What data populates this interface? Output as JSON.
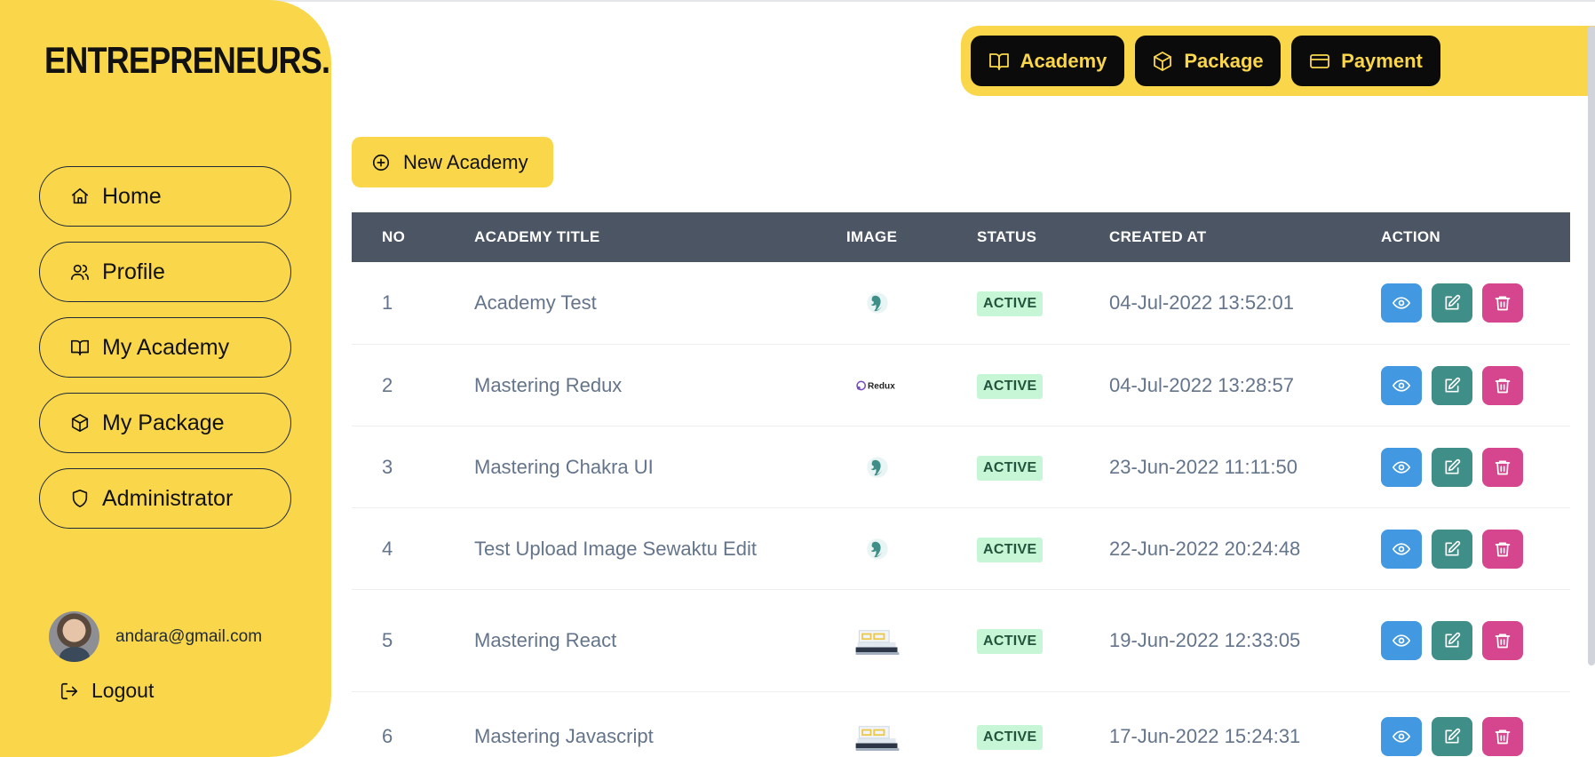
{
  "brand": {
    "logo_text": "ENTREPRENEURS."
  },
  "sidebar": {
    "items": [
      {
        "label": "Home",
        "icon": "home-icon"
      },
      {
        "label": "Profile",
        "icon": "users-icon"
      },
      {
        "label": "My Academy",
        "icon": "book-icon"
      },
      {
        "label": "My Package",
        "icon": "box-icon"
      },
      {
        "label": "Administrator",
        "icon": "shield-icon"
      }
    ],
    "user": {
      "email": "andara@gmail.com"
    },
    "logout_label": "Logout"
  },
  "topbar": {
    "buttons": [
      {
        "label": "Academy",
        "icon": "book-icon"
      },
      {
        "label": "Package",
        "icon": "box-icon"
      },
      {
        "label": "Payment",
        "icon": "card-icon"
      }
    ]
  },
  "main": {
    "new_button_label": "New Academy",
    "table": {
      "headers": [
        "NO",
        "ACADEMY TITLE",
        "IMAGE",
        "STATUS",
        "CREATED AT",
        "ACTION"
      ],
      "rows": [
        {
          "no": "1",
          "title": "Academy Test",
          "image": "chakra-logo",
          "status": "ACTIVE",
          "created_at": "04-Jul-2022 13:52:01"
        },
        {
          "no": "2",
          "title": "Mastering Redux",
          "image": "redux-logo",
          "image_text": "Redux",
          "status": "ACTIVE",
          "created_at": "04-Jul-2022 13:28:57"
        },
        {
          "no": "3",
          "title": "Mastering Chakra UI",
          "image": "chakra-logo",
          "status": "ACTIVE",
          "created_at": "23-Jun-2022 11:11:50"
        },
        {
          "no": "4",
          "title": "Test Upload Image Sewaktu Edit",
          "image": "chakra-logo",
          "status": "ACTIVE",
          "created_at": "22-Jun-2022 20:24:48"
        },
        {
          "no": "5",
          "title": "Mastering React",
          "image": "books-photo",
          "status": "ACTIVE",
          "created_at": "19-Jun-2022 12:33:05"
        },
        {
          "no": "6",
          "title": "Mastering Javascript",
          "image": "books-photo",
          "status": "ACTIVE",
          "created_at": "17-Jun-2022 15:24:31"
        }
      ]
    }
  },
  "colors": {
    "accent": "#fad74a",
    "header_bg": "#4b5563",
    "view": "#4299e1",
    "edit": "#3f8f88",
    "delete": "#d5468f",
    "badge_bg": "#c6f6d5"
  }
}
